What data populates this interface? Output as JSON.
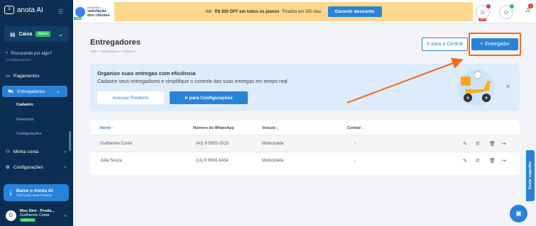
{
  "sidebar": {
    "logo_text": "anota AI",
    "logo_box": "anota AI",
    "caixa_label": "Caixa",
    "caixa_status": "Aberto",
    "search_placeholder": "Procurando por algo?",
    "peek_label": "Configurações",
    "items": [
      {
        "label": "Pagamentos"
      },
      {
        "label": "Entregadores"
      },
      {
        "label": "Minha conta"
      },
      {
        "label": "Configurações"
      }
    ],
    "sub_items": [
      "Cadastro",
      "Relatórios",
      "Configurações"
    ],
    "download_title": "Baixe o Anota AI",
    "download_sub": "Você pode estar limitado!",
    "store_name": "Meu Stró - Produ...",
    "store_user": "Guilherme Costa",
    "store_status": "ABERTO",
    "avatar_letter": "G"
  },
  "topbar": {
    "survey_line1": "Aumente a",
    "survey_line2": "satisfação",
    "survey_line3": "dos clientes",
    "survey_tag": "Grátis",
    "promo_pre": "Até",
    "promo_bold": "R$ 200 OFF em todos os planos",
    "promo_post": "Finaliza em 350 dias",
    "promo_cta": "Garantir desconto",
    "off_tag": "OFF",
    "bell_count": "1"
  },
  "main": {
    "title": "Entregadores",
    "breadcrumb": "Início  •  Entregadores  •  Cadastro",
    "btn_central": "Ir para a Central",
    "btn_add": "Entregador",
    "btn_add_icon": "+",
    "banner": {
      "heading": "Organize suas entregas com eficiência",
      "text": "Cadastre seus entregadores e simplifique o controle das suas entregas em tempo real",
      "btn_report": "Acessar Relatório",
      "btn_config": "Ir para Configurações"
    },
    "table": {
      "headers": [
        "Nome",
        "Número do WhatsApp",
        "Veículo",
        "Central"
      ],
      "rows": [
        {
          "name": "Guilherme Costa",
          "phone": "(41) 9 9505-2015",
          "vehicle": "Motocicleta",
          "central": "-"
        },
        {
          "name": "Julia Souza",
          "phone": "(11) 9 9661-6434",
          "vehicle": "Motocicleta",
          "central": "-"
        }
      ]
    }
  },
  "widgets": {
    "survey_tab": "Enviar sugestão"
  },
  "colors": {
    "sidebar": "#0b2e52",
    "accent": "#2a82d8",
    "highlight": "#f26b1d",
    "promo": "#fdd78a",
    "success": "#22c55e"
  }
}
